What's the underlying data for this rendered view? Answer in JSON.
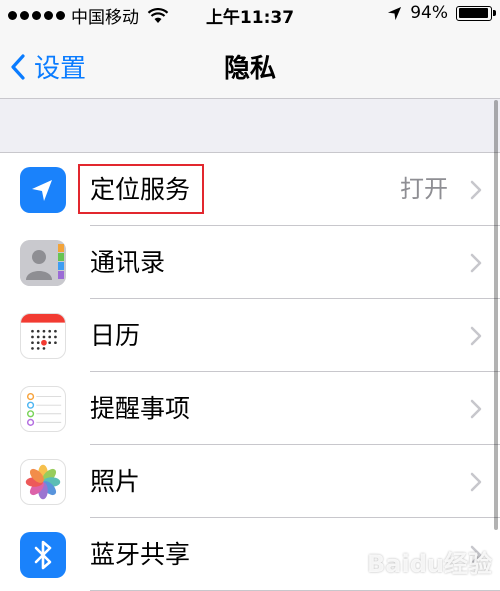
{
  "status_bar": {
    "carrier": "中国移动",
    "time": "上午11:37",
    "battery_percent_text": "94%",
    "battery_level": 0.94
  },
  "nav": {
    "back_label": "设置",
    "title": "隐私"
  },
  "rows": [
    {
      "label": "定位服务",
      "value": "打开",
      "icon": "location-icon"
    },
    {
      "label": "通讯录",
      "value": "",
      "icon": "contacts-icon"
    },
    {
      "label": "日历",
      "value": "",
      "icon": "calendar-icon"
    },
    {
      "label": "提醒事项",
      "value": "",
      "icon": "reminders-icon"
    },
    {
      "label": "照片",
      "value": "",
      "icon": "photos-icon"
    },
    {
      "label": "蓝牙共享",
      "value": "",
      "icon": "bluetooth-icon"
    }
  ],
  "colors": {
    "accent": "#0a7cff",
    "highlight": "#e2272e",
    "background": "#efeff4"
  },
  "watermark": "Baidu经验"
}
